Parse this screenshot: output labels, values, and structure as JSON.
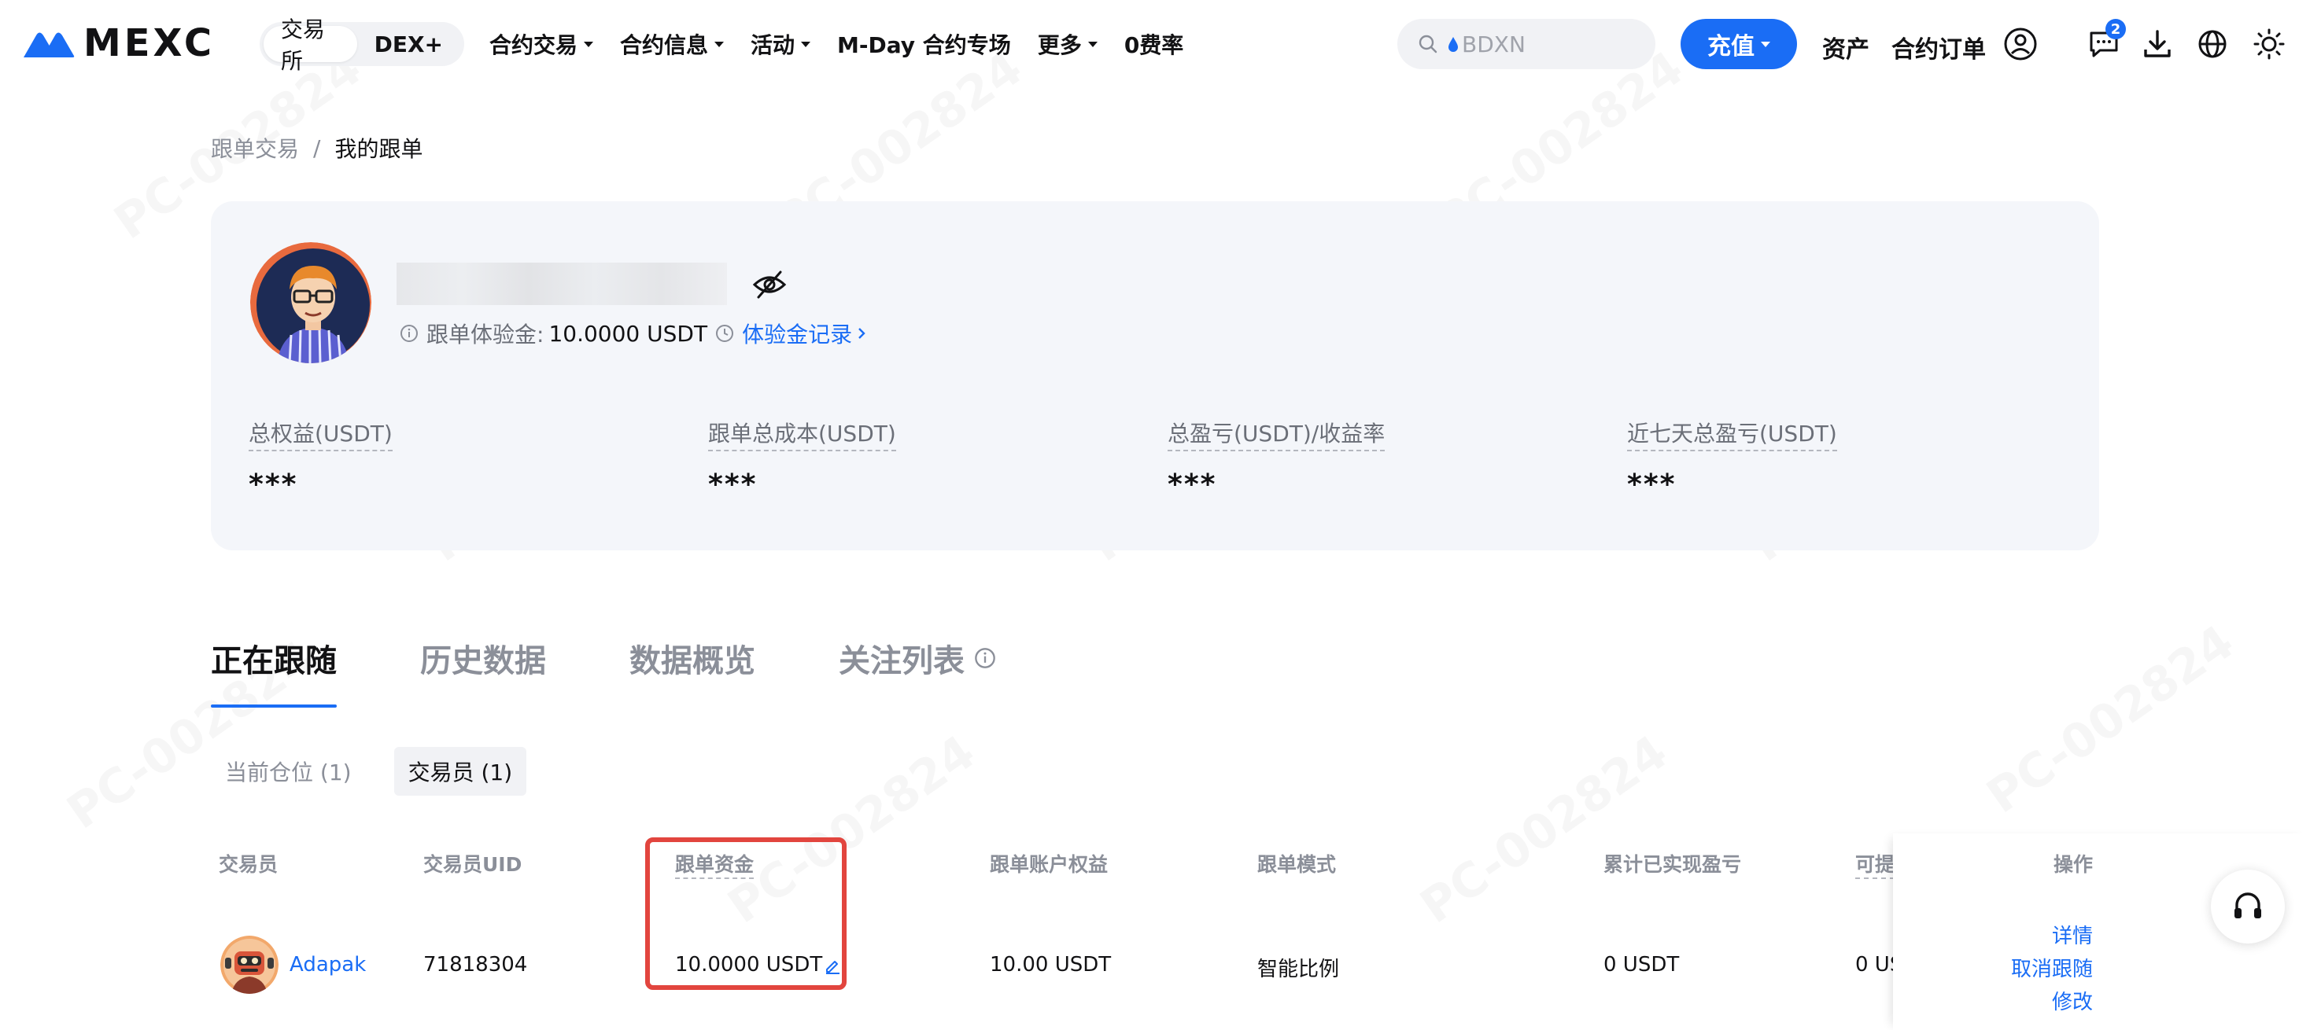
{
  "brand": {
    "name": "MEXC",
    "accent": "#1a6df5"
  },
  "nav": {
    "market_switch": [
      "交易所",
      "DEX+"
    ],
    "links": [
      {
        "label": "合约交易",
        "dropdown": true
      },
      {
        "label": "合约信息",
        "dropdown": true
      },
      {
        "label": "活动",
        "dropdown": true
      },
      {
        "label": "M-Day 合约专场",
        "dropdown": false
      },
      {
        "label": "更多",
        "dropdown": true
      },
      {
        "label": "0费率",
        "dropdown": false
      }
    ],
    "search_placeholder": "BDXN",
    "deposit_label": "充值",
    "assets_label": "资产",
    "orders_label": "合约订单",
    "message_count": "2",
    "icons": [
      "user-icon",
      "message-icon",
      "download-icon",
      "globe-icon",
      "sun-icon"
    ]
  },
  "breadcrumb": {
    "parent": "跟单交易",
    "separator": "/",
    "current": "我的跟单"
  },
  "profile": {
    "trial_label": "跟单体验金:",
    "trial_value": "10.0000 USDT",
    "trial_record_label": "体验金记录",
    "stats": [
      {
        "label": "总权益(USDT)",
        "value": "***"
      },
      {
        "label": "跟单总成本(USDT)",
        "value": "***"
      },
      {
        "label": "总盈亏(USDT)/收益率",
        "value": "***"
      },
      {
        "label": "近七天总盈亏(USDT)",
        "value": "***"
      }
    ]
  },
  "tabs": [
    "正在跟随",
    "历史数据",
    "数据概览",
    "关注列表"
  ],
  "subtabs": [
    "当前仓位 (1)",
    "交易员 (1)"
  ],
  "table": {
    "headers": {
      "trader": "交易员",
      "uid": "交易员UID",
      "funds": "跟单资金",
      "equity": "跟单账户权益",
      "mode": "跟单模式",
      "realized": "累计已实现盈亏",
      "withdrawable": "可提",
      "actions": "操作"
    },
    "row": {
      "trader": "Adapak",
      "uid": "71818304",
      "funds": "10.0000 USDT",
      "equity": "10.00 USDT",
      "mode": "智能比例",
      "realized": "0 USDT",
      "withdrawable": "0 US",
      "actions": [
        "详情",
        "取消跟随",
        "修改"
      ]
    }
  },
  "watermark": "PC-002824"
}
